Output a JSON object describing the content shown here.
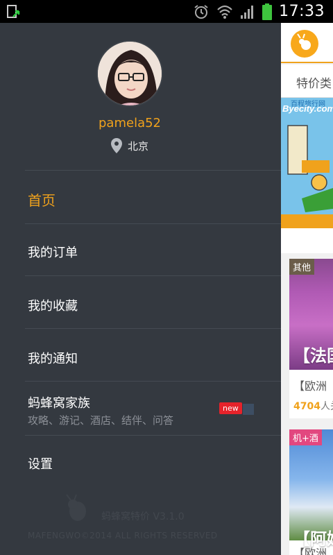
{
  "status_bar": {
    "time": "17:33",
    "icons": [
      "screenshot-icon",
      "alarm-icon",
      "wifi-icon",
      "signal-icon",
      "battery-icon"
    ]
  },
  "drawer": {
    "profile": {
      "username": "pamela52",
      "city": "北京"
    },
    "menu": {
      "home": "首页",
      "orders": "我的订单",
      "favorites": "我的收藏",
      "notifications": "我的通知",
      "family": "蚂蜂窝家族",
      "family_sub": "攻略、游记、酒店、结伴、问答",
      "family_badge": "new",
      "settings": "设置"
    },
    "footer": {
      "version": "蚂蜂窝特价  V3.1.0",
      "copyright": "MAFENGWO©2014 ALL RIGHTS RESERVED"
    }
  },
  "background": {
    "tab": "特价类",
    "banner_brand": "Byecity.com",
    "banner_brand_small": "百程旅行网",
    "cards": [
      {
        "badge": "其他",
        "title": "【法国",
        "subtitle": "【欧洲",
        "count": "4704",
        "count_unit": "人关"
      },
      {
        "badge": "机+酒",
        "title": "【阿姆",
        "subtitle": "【欧洲"
      }
    ]
  },
  "colors": {
    "accent": "#f0a21c",
    "drawer_bg": "#343940",
    "badge_new": "#e6232b"
  }
}
